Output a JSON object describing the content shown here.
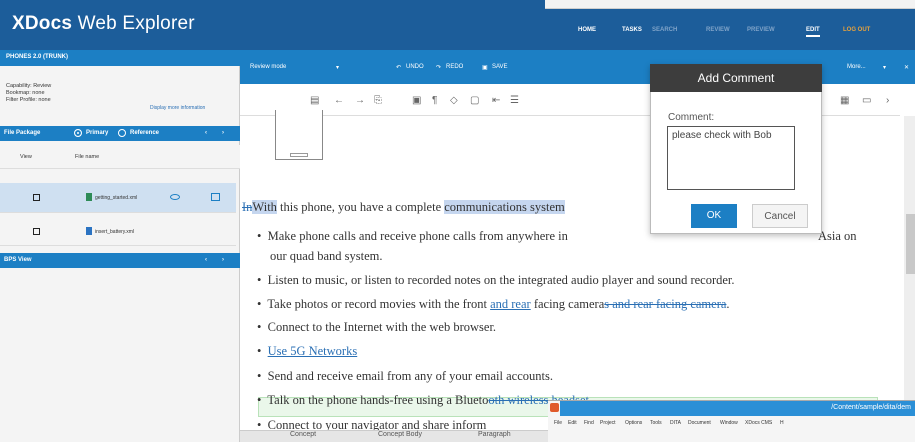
{
  "app": {
    "logo_bold": "XDocs",
    "logo_rest": " Web Explorer"
  },
  "topnav": [
    "HOME",
    "TASKS",
    "SEARCH",
    "REVIEW",
    "PREVIEW",
    "EDIT",
    "LOG OUT"
  ],
  "sidebar": {
    "title": "PHONES 2.0 (TRUNK)",
    "info": [
      "Capability: Review",
      "Bookmap: none",
      "Filter Profile: none"
    ],
    "more_link": "Display more information",
    "tab_label": "File Package",
    "radio1": "Primary",
    "radio2": "Reference",
    "col_view": "View",
    "col_file": "File name",
    "files": [
      "getting_started.xml",
      "insert_battery.xml"
    ],
    "panel2": "BPS View"
  },
  "editor": {
    "mode": "Review mode",
    "undo": "UNDO",
    "redo": "REDO",
    "save": "SAVE",
    "more": "More...",
    "intro": [
      "In",
      "With",
      " this phone, you have a complete ",
      "communications system",
      ""
    ],
    "bullets": [
      "Make phone calls and receive phone calls from anywhere in",
      "our quad band system.",
      "Listen to music, or listen to recorded notes on the integrated audio player and sound recorder.",
      "Connect to the Internet with the web browser.",
      "Use 5G Networks",
      "Send and receive email from any of your email accounts."
    ],
    "b1_tail": "Asia on",
    "photo": {
      "pre": "Take photos or record movies with the front ",
      "ins": "and rear",
      " mid": " facing camera",
      "del": "s and rear facing camera",
      "end": "."
    },
    "bt": "Talk on the phone hands-free using a Blueto",
    "bt2": "oth wireless headset.",
    "cut": "Connect to your navigator and share inform",
    "bottom_tabs": [
      "Concept",
      "Concept Body",
      "Paragraph"
    ]
  },
  "dialog": {
    "title": "Add Comment",
    "label": "Comment:",
    "text": "please check with Bob",
    "ok": "OK",
    "cancel": "Cancel"
  },
  "win2": {
    "path": "/Content/sample/dita/dem",
    "menu": [
      "File",
      "Edit",
      "Find",
      "Project",
      "Options",
      "Tools",
      "DITA",
      "Document",
      "Window",
      "XDocs CMS",
      "H"
    ]
  }
}
